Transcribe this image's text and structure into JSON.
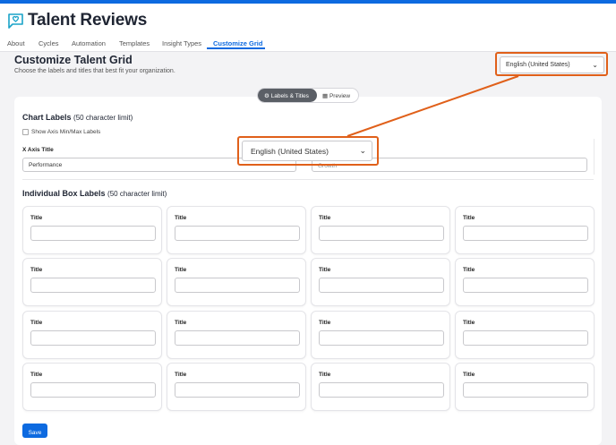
{
  "app": {
    "title": "Talent Reviews"
  },
  "nav": {
    "items": [
      {
        "label": "About"
      },
      {
        "label": "Cycles"
      },
      {
        "label": "Automation"
      },
      {
        "label": "Templates"
      },
      {
        "label": "Insight Types"
      },
      {
        "label": "Customize Grid"
      }
    ],
    "active": "Customize Grid"
  },
  "page": {
    "title": "Customize Talent Grid",
    "subtitle": "Choose the labels and titles that best fit your organization."
  },
  "language_select": {
    "value": "English (United States)"
  },
  "view_toggle": {
    "options": [
      "Labels & Titles",
      "Preview"
    ],
    "selected": "Labels & Titles"
  },
  "chart_labels": {
    "title": "Chart Labels",
    "note": "(50 character limit)",
    "show_axis_minmax_label": "Show Axis Min/Max Labels",
    "x_axis_title_label": "X Axis Title",
    "x_axis_title_value": "Performance",
    "y_axis_title_value": "Growth"
  },
  "box_labels": {
    "title": "Individual Box Labels",
    "note": "(50 character limit)",
    "field_label": "Title"
  },
  "save_label": "Save",
  "colors": {
    "accent": "#0d6ae0",
    "callout": "#e0601a"
  }
}
